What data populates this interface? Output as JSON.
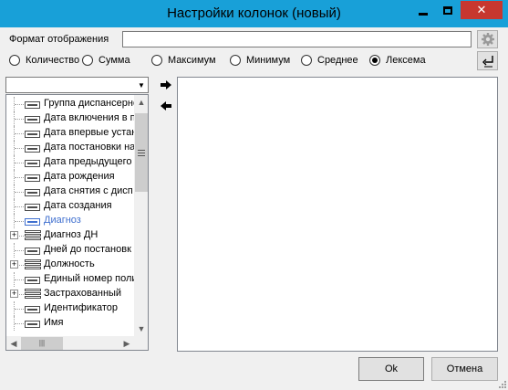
{
  "window": {
    "title": "Настройки колонок (новый)",
    "min_glyph": "",
    "max_glyph": "",
    "close_glyph": "✕"
  },
  "format": {
    "label": "Формат отображения",
    "value": ""
  },
  "aggregation": {
    "options": [
      "Количество",
      "Сумма",
      "Максимум",
      "Минимум",
      "Среднее",
      "Лексема"
    ],
    "selected": "Лексема"
  },
  "field_list": {
    "combo_value": "",
    "items": [
      {
        "label": "Группа диспансерно",
        "kind": "field",
        "expandable": false
      },
      {
        "label": "Дата включения в п",
        "kind": "field",
        "expandable": false
      },
      {
        "label": "Дата впервые устан",
        "kind": "field",
        "expandable": false
      },
      {
        "label": "Дата постановки на",
        "kind": "field",
        "expandable": false
      },
      {
        "label": "Дата предыдущего",
        "kind": "field",
        "expandable": false
      },
      {
        "label": "Дата рождения",
        "kind": "field",
        "expandable": false
      },
      {
        "label": "Дата снятия с дисп",
        "kind": "field",
        "expandable": false
      },
      {
        "label": "Дата создания",
        "kind": "field",
        "expandable": false
      },
      {
        "label": "Диагноз",
        "kind": "field",
        "expandable": false,
        "selected": true
      },
      {
        "label": "Диагноз ДН",
        "kind": "group",
        "expandable": true
      },
      {
        "label": "Дней до постановк",
        "kind": "field",
        "expandable": false
      },
      {
        "label": "Должность",
        "kind": "group",
        "expandable": true
      },
      {
        "label": "Единый номер поли",
        "kind": "field",
        "expandable": false
      },
      {
        "label": "Застрахованный",
        "kind": "group",
        "expandable": true
      },
      {
        "label": "Идентификатор",
        "kind": "field",
        "expandable": false
      },
      {
        "label": "Имя",
        "kind": "field",
        "expandable": false
      }
    ]
  },
  "buttons": {
    "ok": "Ok",
    "cancel": "Отмена"
  },
  "colors": {
    "titlebar": "#18a0d8",
    "close": "#c7372f",
    "selected_text": "#3f6fcf"
  }
}
